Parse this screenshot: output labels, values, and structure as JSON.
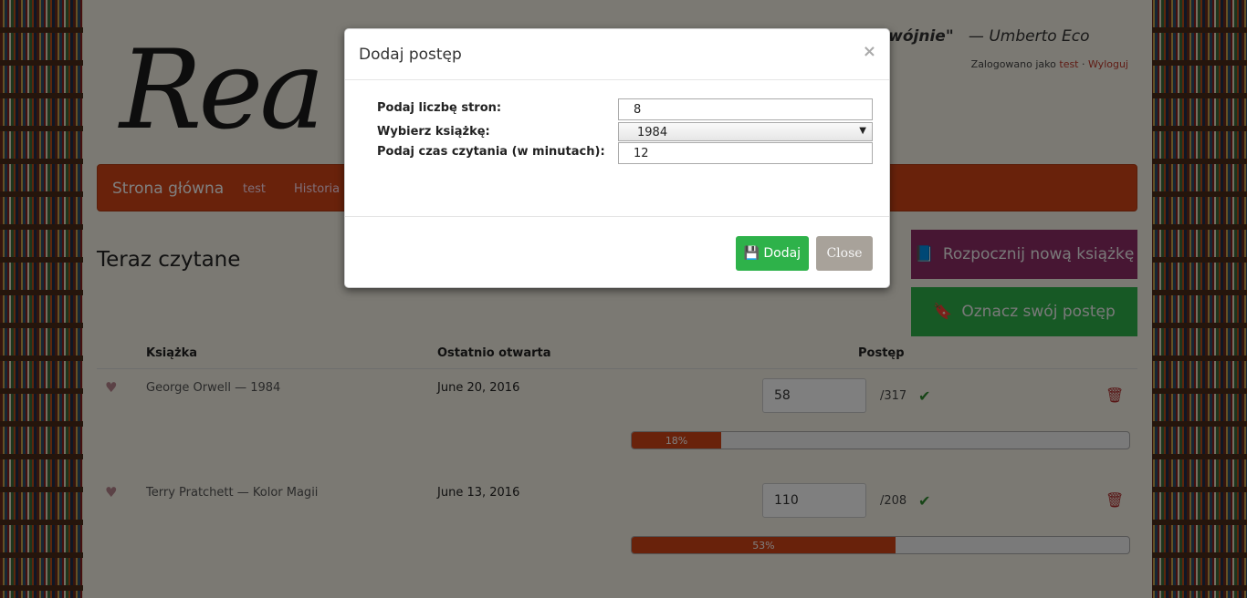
{
  "header": {
    "logo_text": "Rea",
    "quote_part_bold": "dwójnie\"",
    "quote_author": "— Umberto Eco",
    "logged_as_label": "Zalogowano jako",
    "logged_user": "test",
    "separator": "·",
    "logout_label": "Wyloguj"
  },
  "nav": {
    "brand": "Strona główna",
    "items": [
      "test",
      "Historia c"
    ]
  },
  "main": {
    "heading": "Teraz czytane",
    "start_button": "Rozpocznij nową książkę",
    "mark_button": "Oznacz swój postęp",
    "table": {
      "headers": [
        "Książka",
        "Ostatnio otwarta",
        "Postęp"
      ],
      "rows": [
        {
          "title": "George Orwell — 1984",
          "date": "June 20, 2016",
          "page": "58",
          "total": "/317",
          "percent_label": "18%",
          "percent": 18
        },
        {
          "title": "Terry Pratchett — Kolor Magii",
          "date": "June 13, 2016",
          "page": "110",
          "total": "/208",
          "percent_label": "53%",
          "percent": 53
        }
      ]
    }
  },
  "modal": {
    "title": "Dodaj postęp",
    "close_symbol": "×",
    "pages_label": "Podaj liczbę stron:",
    "pages_value": "8",
    "book_label": "Wybierz książkę:",
    "book_value": "1984",
    "time_label": "Podaj czas czytania (w minutach):",
    "time_value": "12",
    "add_button": "Dodaj",
    "close_button": "Close"
  },
  "colors": {
    "accent": "#d24417",
    "success": "#2eb24a",
    "purple": "#8e2c66"
  }
}
